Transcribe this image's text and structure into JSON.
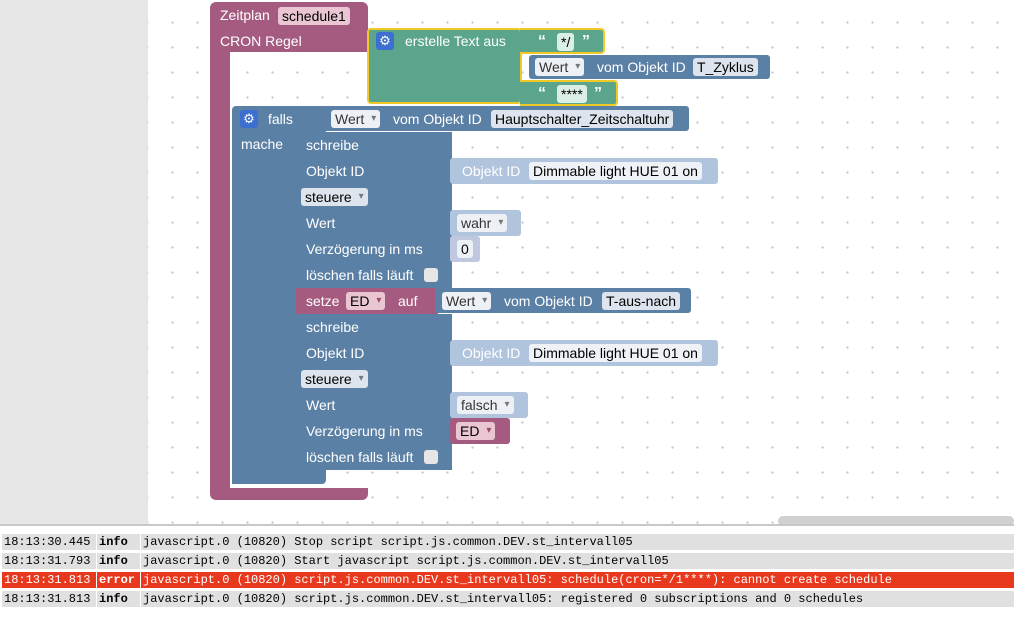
{
  "blocks": {
    "schedule": {
      "title": "Zeitplan",
      "name": "schedule1",
      "cron_label": "CRON Regel"
    },
    "text_join": {
      "label": "erstelle Text aus",
      "item1": "*/",
      "item3": "****"
    },
    "value_zyklus": {
      "attr": "Wert",
      "of_object": "vom Objekt ID",
      "object_id": "T_Zyklus"
    },
    "if_block": {
      "label_if": "falls",
      "label_do": "mache"
    },
    "value_main": {
      "attr": "Wert",
      "of_object": "vom Objekt ID",
      "object_id": "Hauptschalter_Zeitschaltuhr"
    },
    "write1": {
      "title": "schreibe",
      "object_label": "Objekt ID",
      "mode": "steuere",
      "value_label": "Wert",
      "delay_label": "Verzögerung in ms",
      "clear_label": "löschen falls läuft",
      "object_prefix": "Objekt ID",
      "object_name": "Dimmable light HUE 01 on",
      "value": "wahr",
      "delay": "0"
    },
    "set_var": {
      "label_set": "setze",
      "variable": "ED",
      "label_to": "auf",
      "attr": "Wert",
      "of_object": "vom Objekt ID",
      "object_id": "T-aus-nach"
    },
    "write2": {
      "title": "schreibe",
      "object_label": "Objekt ID",
      "mode": "steuere",
      "value_label": "Wert",
      "delay_label": "Verzögerung in ms",
      "clear_label": "löschen falls läuft",
      "object_prefix": "Objekt ID",
      "object_name": "Dimmable light HUE 01 on",
      "value": "falsch",
      "delay_var": "ED"
    }
  },
  "icons": {
    "gear": "gear-icon",
    "quote_open": "“",
    "quote_close": "”"
  },
  "log": [
    {
      "time": "18:13:30.445",
      "level": "info",
      "message": "javascript.0 (10820) Stop script script.js.common.DEV.st_intervall05"
    },
    {
      "time": "18:13:31.793",
      "level": "info",
      "message": "javascript.0 (10820) Start javascript script.js.common.DEV.st_intervall05"
    },
    {
      "time": "18:13:31.813",
      "level": "error",
      "message": "javascript.0 (10820) script.js.common.DEV.st_intervall05: schedule(cron=*/1****): cannot create schedule"
    },
    {
      "time": "18:13:31.813",
      "level": "info",
      "message": "javascript.0 (10820) script.js.common.DEV.st_intervall05: registered 0 subscriptions and 0 schedules"
    }
  ],
  "colors": {
    "schedule_block": "#a55b80",
    "text_block": "#5ba58c",
    "object_block": "#5b80a5",
    "logic_block": "#5b80a5",
    "variable_block": "#a55b80",
    "error_row": "#e8391e",
    "selected_outline": "#f0c928"
  }
}
